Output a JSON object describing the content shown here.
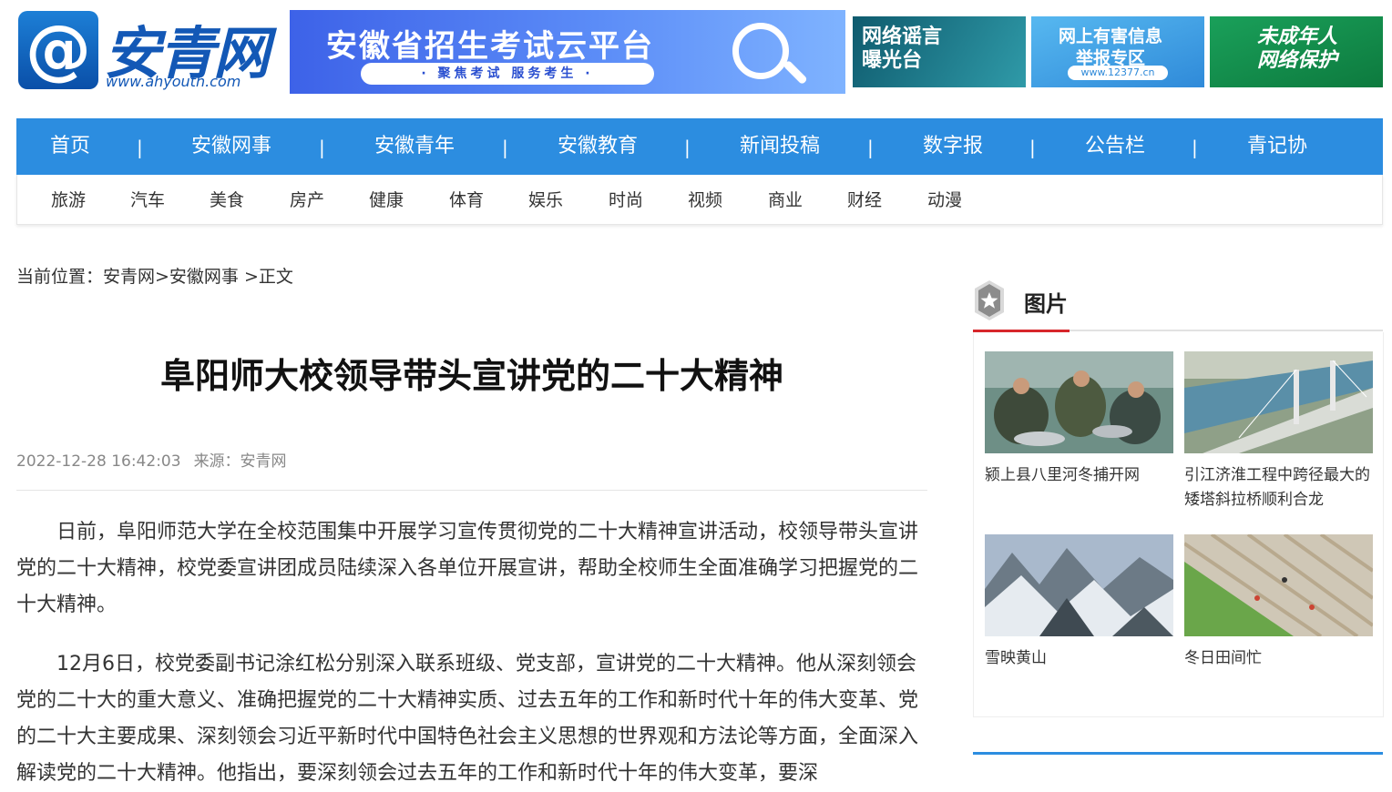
{
  "header": {
    "logo_cn": "安青网",
    "logo_url": "www.ahyouth.com",
    "banner_main": {
      "title": "安徽省招生考试云平台",
      "subtitle": "· 聚焦考试 服务考生 ·"
    },
    "banners": [
      {
        "text": "网络谣言\n曝光台"
      },
      {
        "text": "网上有害信息\n举报专区",
        "small": "www.12377.cn"
      },
      {
        "text": "未成年人\n网络保护"
      }
    ]
  },
  "nav": {
    "items": [
      "首页",
      "安徽网事",
      "安徽青年",
      "安徽教育",
      "新闻投稿",
      "数字报",
      "公告栏",
      "青记协"
    ],
    "separator": "|"
  },
  "subnav": {
    "items": [
      "旅游",
      "汽车",
      "美食",
      "房产",
      "健康",
      "体育",
      "娱乐",
      "时尚",
      "视频",
      "商业",
      "财经",
      "动漫"
    ]
  },
  "breadcrumb": {
    "text": "当前位置：安青网>安徽网事 >正文"
  },
  "article": {
    "title": "阜阳师大校领导带头宣讲党的二十大精神",
    "datetime": "2022-12-28 16:42:03",
    "source": "来源：安青网",
    "paragraphs": [
      "日前，阜阳师范大学在全校范围集中开展学习宣传贯彻党的二十大精神宣讲活动，校领导带头宣讲党的二十大精神，校党委宣讲团成员陆续深入各单位开展宣讲，帮助全校师生全面准确学习把握党的二十大精神。",
      "12月6日，校党委副书记涂红松分别深入联系班级、党支部，宣讲党的二十大精神。他从深刻领会党的二十大的重大意义、准确把握党的二十大精神实质、过去五年的工作和新时代十年的伟大变革、党的二十大主要成果、深刻领会习近平新时代中国特色社会主义思想的世界观和方法论等方面，全面深入解读党的二十大精神。他指出，要深刻领会过去五年的工作和新时代十年的伟大变革，要深"
    ]
  },
  "sidebar": {
    "title": "图片",
    "pictures": [
      {
        "caption": "颍上县八里河冬捕开网",
        "icon": "fishing-photo"
      },
      {
        "caption": "引江济淮工程中跨径最大的矮塔斜拉桥顺利合龙",
        "icon": "bridge-photo"
      },
      {
        "caption": "雪映黄山",
        "icon": "mountain-snow-photo"
      },
      {
        "caption": "冬日田间忙",
        "icon": "farmland-photo"
      }
    ]
  },
  "colors": {
    "nav_blue": "#2c8de0",
    "accent_red": "#d7262b",
    "logo_blue": "#1358b6"
  }
}
